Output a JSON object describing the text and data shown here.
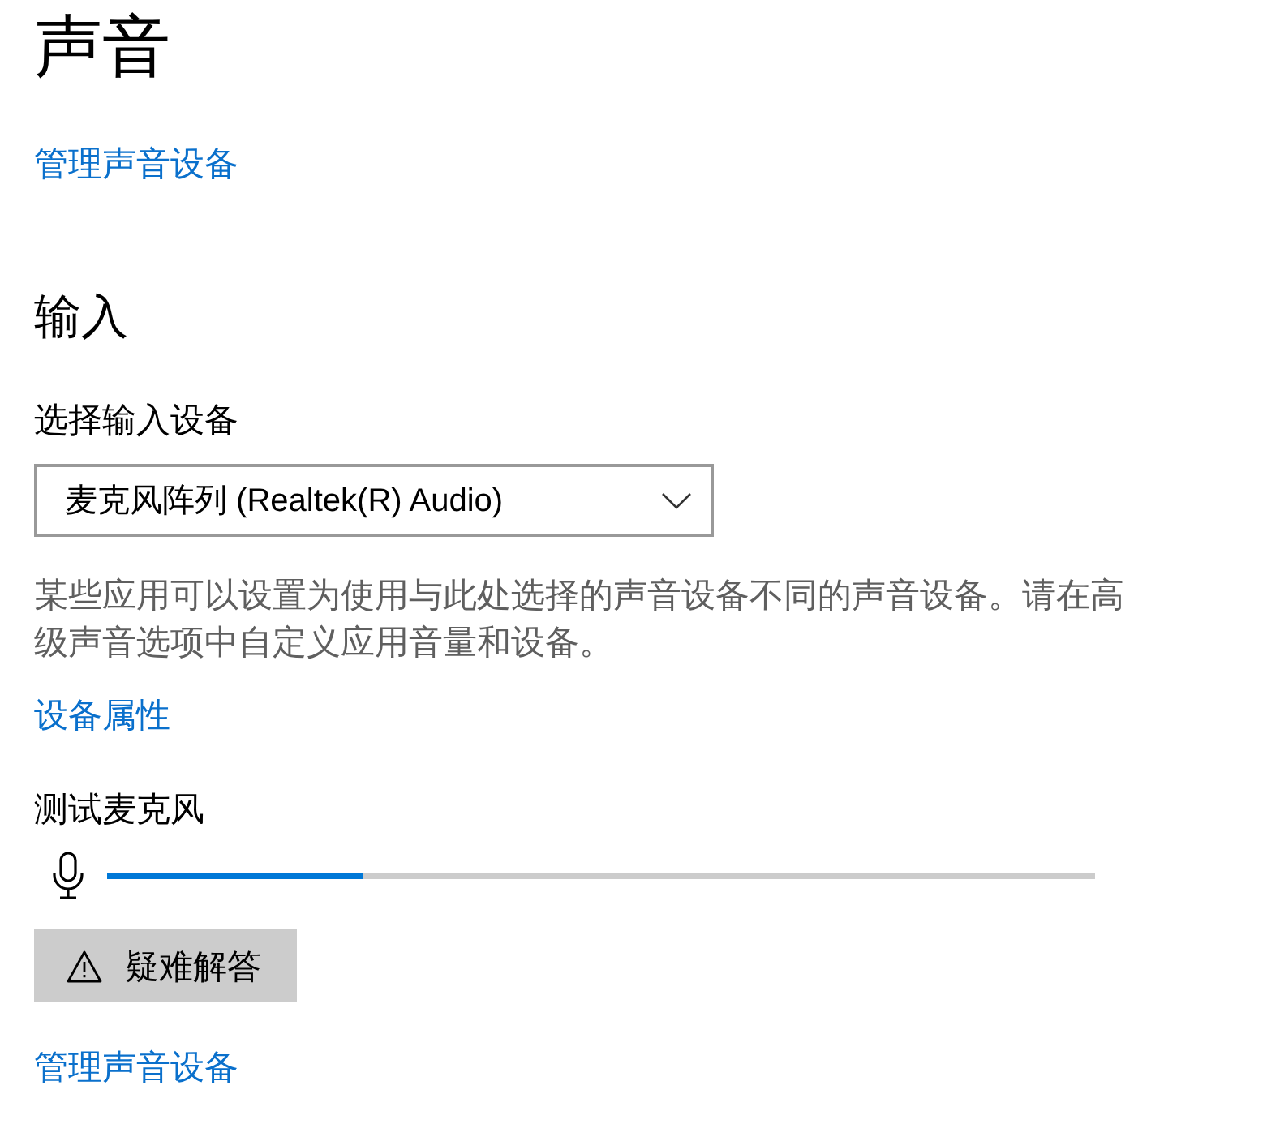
{
  "title": "声音",
  "manage_link": "管理声音设备",
  "input_section": {
    "heading": "输入",
    "device_label": "选择输入设备",
    "device_select": {
      "value": "麦克风阵列 (Realtek(R) Audio)"
    },
    "description": "某些应用可以设置为使用与此处选择的声音设备不同的声音设备。请在高级声音选项中自定义应用音量和设备。",
    "properties_link": "设备属性",
    "test_label": "测试麦克风",
    "mic_meter": {
      "level": 0.26
    },
    "troubleshoot_button": "疑难解答"
  },
  "bottom_link": "管理声音设备"
}
